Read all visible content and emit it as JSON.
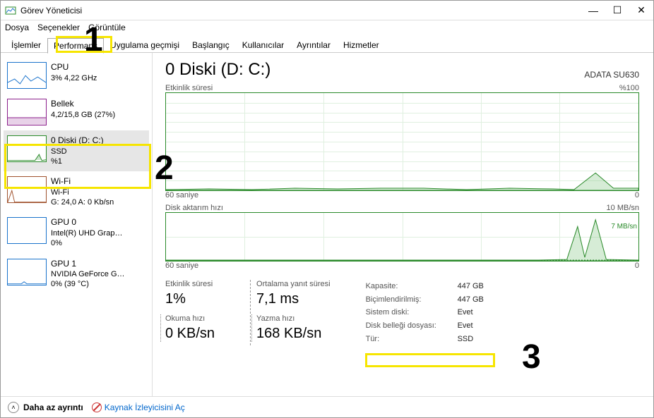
{
  "window": {
    "title": "Görev Yöneticisi",
    "minimize": "—",
    "maximize": "☐",
    "close": "✕"
  },
  "menu": {
    "file": "Dosya",
    "options": "Seçenekler",
    "view": "Görüntüle"
  },
  "tabs": {
    "processes": "İşlemler",
    "performance": "Performans",
    "apphistory": "Uygulama geçmişi",
    "startup": "Başlangıç",
    "users": "Kullanıcılar",
    "details": "Ayrıntılar",
    "services": "Hizmetler"
  },
  "sidebar": {
    "cpu": {
      "title": "CPU",
      "sub": "3% 4,22 GHz"
    },
    "memory": {
      "title": "Bellek",
      "sub": "4,2/15,8 GB (27%)"
    },
    "disk": {
      "title": "0 Diski (D: C:)",
      "sub1": "SSD",
      "sub2": "%1"
    },
    "wifi": {
      "title": "Wi-Fi",
      "sub1": "Wi-Fi",
      "sub2": "G: 24,0 A: 0 Kb/sn"
    },
    "gpu0": {
      "title": "GPU 0",
      "sub1": "Intel(R) UHD Grap…",
      "sub2": "0%"
    },
    "gpu1": {
      "title": "GPU 1",
      "sub1": "NVIDIA GeForce G…",
      "sub2": "0% (39 °C)"
    }
  },
  "main": {
    "title": "0 Diski (D: C:)",
    "model": "ADATA SU630",
    "chart1": {
      "top_left": "Etkinlik süresi",
      "top_right": "%100",
      "bottom_left": "60 saniye",
      "bottom_right": "0"
    },
    "chart2": {
      "top_left": "Disk aktarım hızı",
      "top_right": "10 MB/sn",
      "mid_right": "7 MB/sn",
      "bottom_left": "60 saniye",
      "bottom_right": "0"
    },
    "stats": {
      "activity_label": "Etkinlik süresi",
      "activity_value": "1%",
      "avgresp_label": "Ortalama yanıt süresi",
      "avgresp_value": "7,1 ms",
      "read_label": "Okuma hızı",
      "read_value": "0 KB/sn",
      "write_label": "Yazma hızı",
      "write_value": "168 KB/sn"
    },
    "props": {
      "capacity_k": "Kapasite:",
      "capacity_v": "447 GB",
      "formatted_k": "Biçimlendirilmiş:",
      "formatted_v": "447 GB",
      "sysdisk_k": "Sistem diski:",
      "sysdisk_v": "Evet",
      "pagefile_k": "Disk belleği dosyası:",
      "pagefile_v": "Evet",
      "type_k": "Tür:",
      "type_v": "SSD"
    }
  },
  "footer": {
    "fewer": "Daha az ayrıntı",
    "resmon": "Kaynak İzleyicisini Aç"
  },
  "annotations": {
    "n1": "1",
    "n2": "2",
    "n3": "3"
  },
  "chart_data": [
    {
      "type": "area",
      "title": "Etkinlik süresi",
      "xlabel": "60 saniye",
      "ylabel": "%",
      "ylim": [
        0,
        100
      ],
      "x_seconds": [
        60,
        55,
        50,
        45,
        40,
        35,
        30,
        25,
        20,
        15,
        10,
        5,
        0
      ],
      "values_pct": [
        1,
        1,
        1,
        2,
        1,
        2,
        2,
        1,
        2,
        1,
        1,
        18,
        3
      ]
    },
    {
      "type": "area",
      "title": "Disk aktarım hızı",
      "xlabel": "60 saniye",
      "ylabel": "MB/sn",
      "ylim": [
        0,
        10
      ],
      "x_seconds": [
        60,
        55,
        50,
        45,
        40,
        35,
        30,
        25,
        20,
        15,
        10,
        5,
        0
      ],
      "series": [
        {
          "name": "Okuma",
          "values_mb_s": [
            0,
            0,
            0,
            0,
            0,
            0,
            0,
            0,
            0,
            0,
            0,
            0,
            0
          ]
        },
        {
          "name": "Yazma",
          "values_mb_s": [
            0.1,
            0.1,
            0.1,
            0.1,
            0.1,
            0.1,
            0.1,
            0.1,
            0.1,
            0.2,
            0.2,
            7,
            0.2
          ]
        }
      ]
    }
  ]
}
